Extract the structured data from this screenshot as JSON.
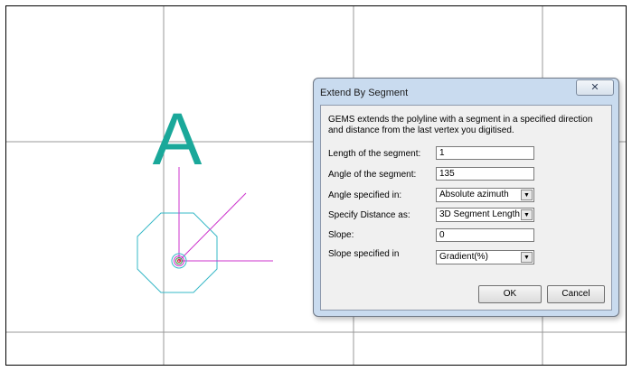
{
  "canvas": {
    "label_text": "A",
    "colors": {
      "label": "#1aa89a",
      "polygon": "#36b8c7",
      "line": "#cc33cc",
      "grid": "#999999"
    }
  },
  "dialog": {
    "title": "Extend By Segment",
    "close_icon": "close-icon",
    "description": "GEMS extends the polyline with a segment in a specified direction and distance from the last vertex you digitised.",
    "fields": {
      "length": {
        "label": "Length of the segment:",
        "value": "1"
      },
      "angle": {
        "label": "Angle of the segment:",
        "value": "135"
      },
      "angle_specified_in": {
        "label": "Angle specified in:",
        "value": "Absolute azimuth"
      },
      "specify_distance_as": {
        "label": "Specify Distance as:",
        "value": "3D Segment Length"
      },
      "slope": {
        "label": "Slope:",
        "value": "0"
      },
      "slope_specified_in": {
        "label": "Slope specified in",
        "value": "Gradient(%)"
      }
    },
    "buttons": {
      "ok": "OK",
      "cancel": "Cancel"
    }
  }
}
